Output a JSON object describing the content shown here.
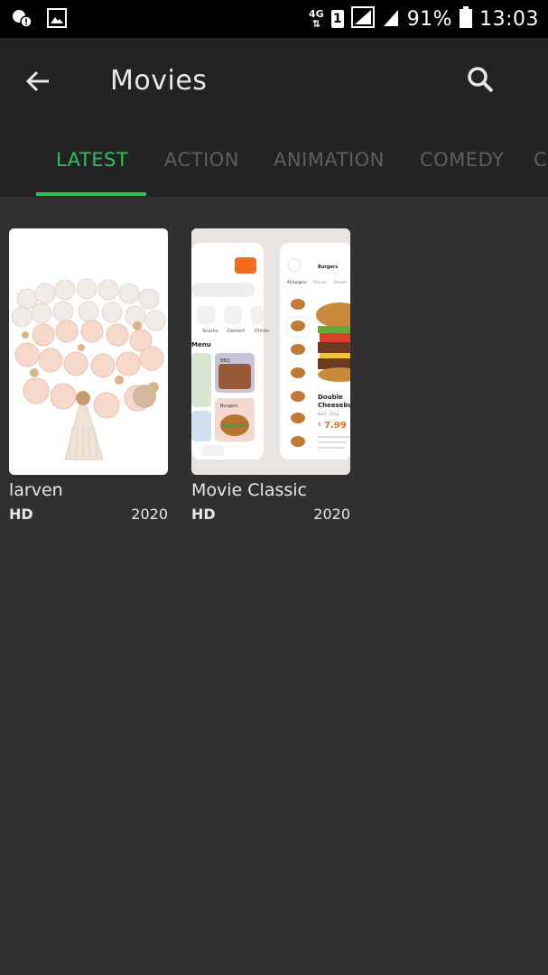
{
  "status_bar": {
    "network": "4G",
    "sim": "1",
    "battery": "91%",
    "time": "13:03",
    "icons": [
      "notification-icon",
      "image-icon",
      "signal-icon",
      "battery-icon"
    ]
  },
  "appbar": {
    "title": "Movies",
    "back_icon": "arrow-left-icon",
    "search_icon": "search-icon"
  },
  "tabs": [
    {
      "label": "LATEST",
      "active": true
    },
    {
      "label": "ACTION",
      "active": false
    },
    {
      "label": "ANIMATION",
      "active": false
    },
    {
      "label": "COMEDY",
      "active": false
    },
    {
      "label": "C",
      "active": false
    }
  ],
  "movies": [
    {
      "title": "larven",
      "quality": "HD",
      "year": "2020",
      "thumb": "bracelet-image"
    },
    {
      "title": "Movie Classic",
      "quality": "HD",
      "year": "2020",
      "thumb": "food-app-screens-image"
    }
  ],
  "thumb2": {
    "heading": "Burgers",
    "tab_all": "All burgers",
    "tab_2": "Popular",
    "tab_3": "Newest",
    "menu": "Menu",
    "cat_1": "Snacks",
    "cat_2": "Dessert",
    "cat_3": "Drinks",
    "tile_bbq": "BBQ",
    "tile_burgers": "Burgers",
    "product_name_1": "Double",
    "product_name_2": "Cheeseburger",
    "product_sub": "Beef · 250g",
    "price_symbol": "$",
    "price": "7.99"
  },
  "colors": {
    "accent": "#2fc05e",
    "appbar": "#232323",
    "background": "#303030",
    "orange": "#f26a1f"
  }
}
